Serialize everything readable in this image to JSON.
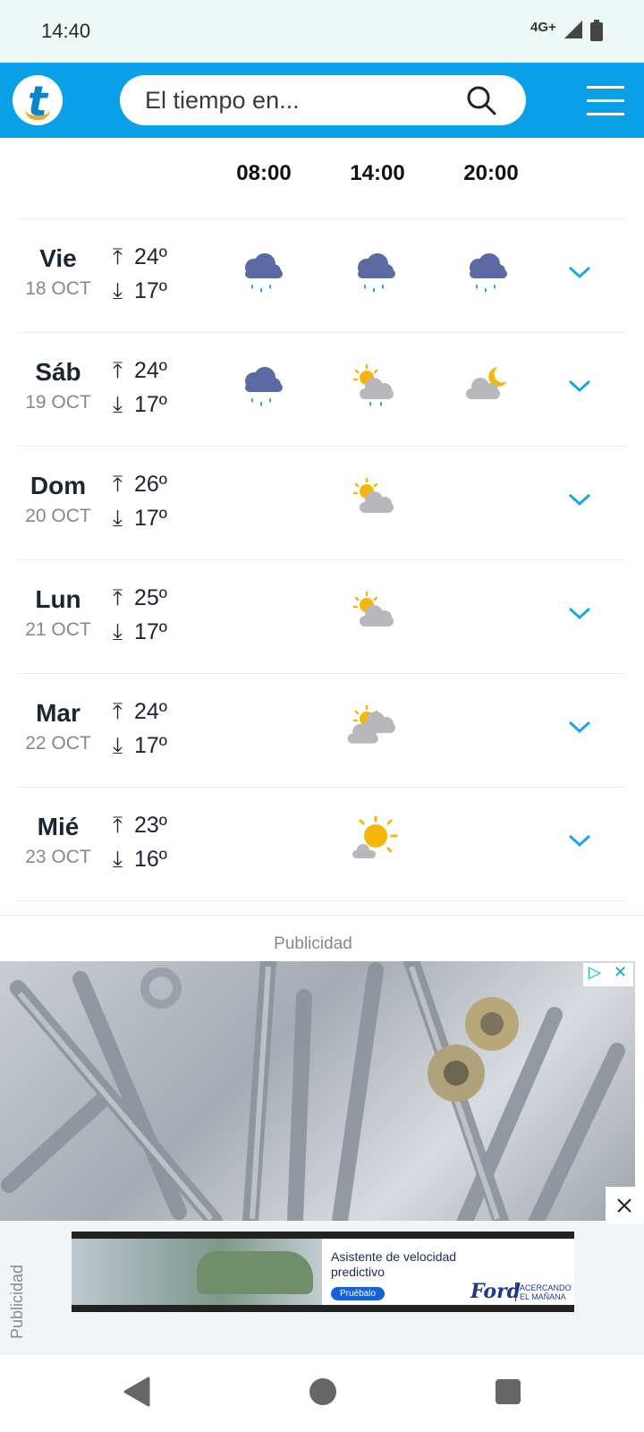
{
  "status_bar": {
    "time": "14:40",
    "network": "4G+"
  },
  "header": {
    "search_placeholder": "El tiempo en..."
  },
  "columns": [
    "08:00",
    "14:00",
    "20:00"
  ],
  "forecast": [
    {
      "day": "Vie",
      "date": "18 OCT",
      "max": "24º",
      "min": "17º",
      "icons": [
        "rain-cloud-icon",
        "rain-cloud-icon",
        "rain-cloud-icon"
      ]
    },
    {
      "day": "Sáb",
      "date": "19 OCT",
      "max": "24º",
      "min": "17º",
      "icons": [
        "rain-cloud-icon",
        "sun-cloud-rain-icon",
        "moon-cloud-icon"
      ]
    },
    {
      "day": "Dom",
      "date": "20 OCT",
      "max": "26º",
      "min": "17º",
      "icons": [
        null,
        "sun-cloud-icon",
        null
      ]
    },
    {
      "day": "Lun",
      "date": "21 OCT",
      "max": "25º",
      "min": "17º",
      "icons": [
        null,
        "sun-cloud-icon",
        null
      ]
    },
    {
      "day": "Mar",
      "date": "22 OCT",
      "max": "24º",
      "min": "17º",
      "icons": [
        null,
        "sun-clouds-icon",
        null
      ]
    },
    {
      "day": "Mié",
      "date": "23 OCT",
      "max": "23º",
      "min": "16º",
      "icons": [
        null,
        "sun-small-cloud-icon",
        null
      ]
    }
  ],
  "ads": {
    "label": "Publicidad",
    "vertical_label": "Publicidad",
    "banner_text": "Asistente de velocidad predictivo",
    "banner_button": "Pruébalo",
    "banner_brand": "Ford",
    "banner_slogan": "ACERCANDO EL MAÑANA"
  },
  "colors": {
    "accent": "#0aa0e8",
    "chevron": "#1aa7e6",
    "rain_cloud": "#5b6aa3",
    "sun": "#f5b50a",
    "grey_cloud": "#b6b8bc"
  }
}
